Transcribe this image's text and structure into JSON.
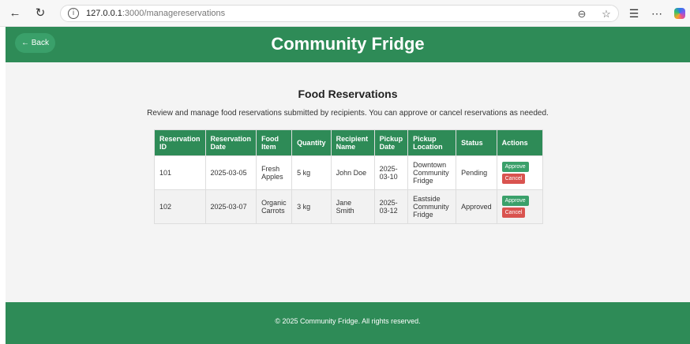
{
  "browser": {
    "url_host": "127.0.0.1",
    "url_path": ":3000/managereservations",
    "icons": [
      "back-arrow-icon",
      "refresh-icon",
      "info-icon",
      "zoom-icon",
      "favorite-star-icon",
      "favorites-list-icon",
      "more-icon",
      "copilot-icon"
    ]
  },
  "header": {
    "back_label": "← Back",
    "title": "Community Fridge"
  },
  "main": {
    "title": "Food Reservations",
    "description": "Review and manage food reservations submitted by recipients. You can approve or cancel reservations as needed."
  },
  "table": {
    "headers": [
      {
        "l1": "Reservation",
        "l2": "ID"
      },
      {
        "l1": "Reservation",
        "l2": "Date"
      },
      {
        "l1": "Food",
        "l2": "Item"
      },
      {
        "l1": "Quantity",
        "l2": ""
      },
      {
        "l1": "Recipient",
        "l2": "Name"
      },
      {
        "l1": "Pickup",
        "l2": "Date"
      },
      {
        "l1": "Pickup",
        "l2": "Location"
      },
      {
        "l1": "Status",
        "l2": ""
      },
      {
        "l1": "Actions",
        "l2": ""
      }
    ],
    "rows": [
      {
        "id": "101",
        "date": "2025-03-05",
        "food": [
          "Fresh",
          "Apples"
        ],
        "quantity": "5 kg",
        "recipient": [
          "John Doe"
        ],
        "pickup_date": [
          "2025-",
          "03-10"
        ],
        "location": [
          "Downtown",
          "Community",
          "Fridge"
        ],
        "status": "Pending",
        "approve_label": "Approve",
        "cancel_label": "Cancel"
      },
      {
        "id": "102",
        "date": "2025-03-07",
        "food": [
          "Organic",
          "Carrots"
        ],
        "quantity": "3 kg",
        "recipient": [
          "Jane",
          "Smith"
        ],
        "pickup_date": [
          "2025-",
          "03-12"
        ],
        "location": [
          "Eastside",
          "Community",
          "Fridge"
        ],
        "status": "Approved",
        "approve_label": "Approve",
        "cancel_label": "Cancel"
      }
    ]
  },
  "footer": {
    "text": "© 2025 Community Fridge. All rights reserved."
  },
  "colors": {
    "primary": "#2e8b57",
    "approve": "#3aa06a",
    "cancel": "#d9534f",
    "page_bg": "#f4f4f4"
  }
}
